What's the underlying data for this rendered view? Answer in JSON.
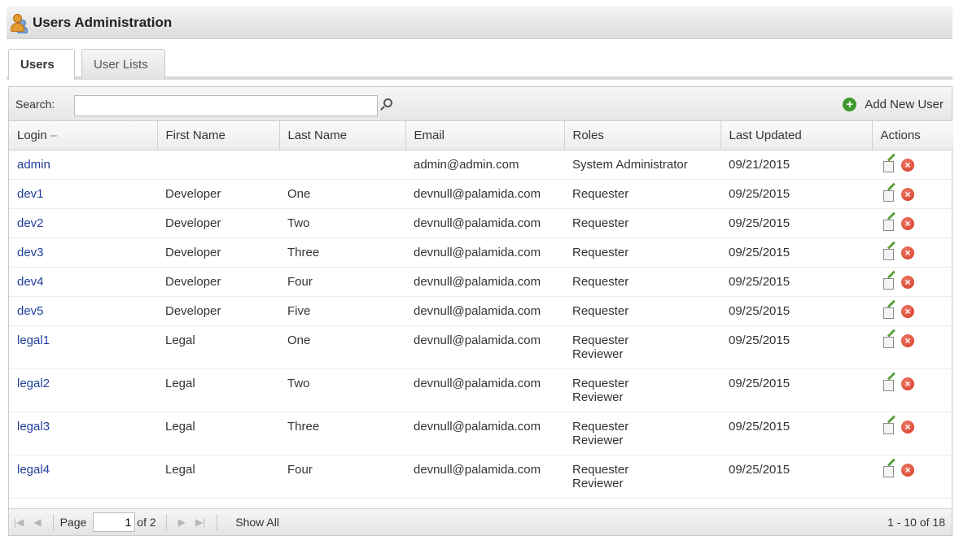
{
  "window": {
    "title": "Users Administration"
  },
  "tabs": [
    {
      "label": "Users",
      "active": true
    },
    {
      "label": "User Lists",
      "active": false
    }
  ],
  "toolbar": {
    "search_label": "Search:",
    "search_value": "",
    "add_user_label": "Add New User"
  },
  "table": {
    "columns": [
      "Login",
      "First Name",
      "Last Name",
      "Email",
      "Roles",
      "Last Updated",
      "Actions"
    ],
    "sort_indicator": "–",
    "rows": [
      {
        "login": "admin",
        "first": "",
        "last": "",
        "email": "admin@admin.com",
        "roles": [
          "System Administrator"
        ],
        "updated": "09/21/2015"
      },
      {
        "login": "dev1",
        "first": "Developer",
        "last": "One",
        "email": "devnull@palamida.com",
        "roles": [
          "Requester"
        ],
        "updated": "09/25/2015"
      },
      {
        "login": "dev2",
        "first": "Developer",
        "last": "Two",
        "email": "devnull@palamida.com",
        "roles": [
          "Requester"
        ],
        "updated": "09/25/2015"
      },
      {
        "login": "dev3",
        "first": "Developer",
        "last": "Three",
        "email": "devnull@palamida.com",
        "roles": [
          "Requester"
        ],
        "updated": "09/25/2015"
      },
      {
        "login": "dev4",
        "first": "Developer",
        "last": "Four",
        "email": "devnull@palamida.com",
        "roles": [
          "Requester"
        ],
        "updated": "09/25/2015"
      },
      {
        "login": "dev5",
        "first": "Developer",
        "last": "Five",
        "email": "devnull@palamida.com",
        "roles": [
          "Requester"
        ],
        "updated": "09/25/2015"
      },
      {
        "login": "legal1",
        "first": "Legal",
        "last": "One",
        "email": "devnull@palamida.com",
        "roles": [
          "Requester",
          "Reviewer"
        ],
        "updated": "09/25/2015"
      },
      {
        "login": "legal2",
        "first": "Legal",
        "last": "Two",
        "email": "devnull@palamida.com",
        "roles": [
          "Requester",
          "Reviewer"
        ],
        "updated": "09/25/2015"
      },
      {
        "login": "legal3",
        "first": "Legal",
        "last": "Three",
        "email": "devnull@palamida.com",
        "roles": [
          "Requester",
          "Reviewer"
        ],
        "updated": "09/25/2015"
      },
      {
        "login": "legal4",
        "first": "Legal",
        "last": "Four",
        "email": "devnull@palamida.com",
        "roles": [
          "Requester",
          "Reviewer"
        ],
        "updated": "09/25/2015"
      }
    ]
  },
  "pager": {
    "page_label": "Page",
    "page_value": "1",
    "of_label": "of 2",
    "show_all_label": "Show All",
    "range_label": "1 - 10 of 18"
  },
  "icons": {
    "app": "users-admin-icon",
    "search": "magnifier-icon",
    "add": "plus-circle-icon",
    "edit": "edit-icon",
    "delete": "delete-icon"
  },
  "colors": {
    "link": "#1f3f99",
    "add": "#3d9a2e",
    "delete": "#d2361e"
  }
}
